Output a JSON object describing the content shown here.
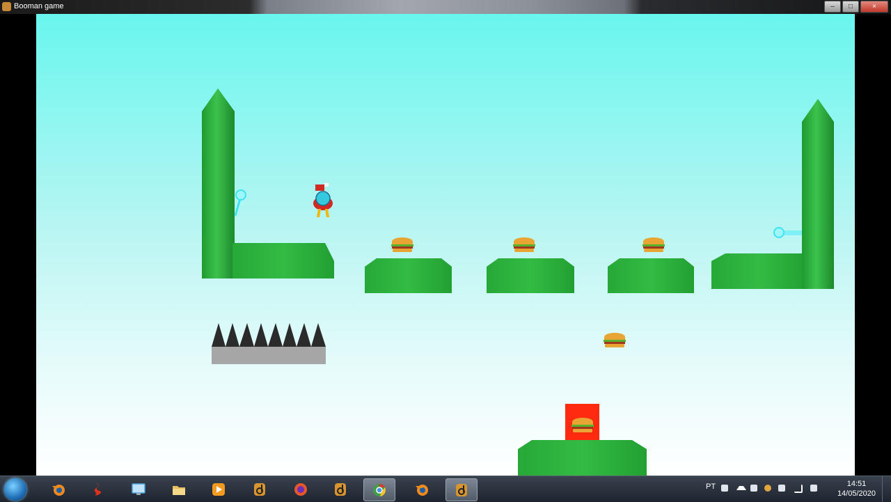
{
  "window": {
    "title": "Booman game"
  },
  "window_controls": {
    "minimize": "–",
    "maximize": "□",
    "close": "×"
  },
  "taskbar": {
    "apps": [
      {
        "name": "start-orb",
        "icon": "windows-logo-icon"
      },
      {
        "name": "blender",
        "icon": "blender-icon",
        "color": "#f08a1c"
      },
      {
        "name": "app-red",
        "icon": "red-s-icon",
        "color": "#e0311e"
      },
      {
        "name": "control-panel",
        "icon": "monitor-icon",
        "color": "#4aa3df"
      },
      {
        "name": "file-explorer",
        "icon": "folder-icon",
        "color": "#e8c060"
      },
      {
        "name": "media-player",
        "icon": "play-icon",
        "color": "#f29a20"
      },
      {
        "name": "game-app-1",
        "icon": "b-logo-icon",
        "color": "#d8952f"
      },
      {
        "name": "firefox",
        "icon": "firefox-icon",
        "color": "#e9562a"
      },
      {
        "name": "game-app-2",
        "icon": "b-logo-icon",
        "color": "#d8952f"
      },
      {
        "name": "chrome",
        "icon": "chrome-icon",
        "color": "#3f9e47"
      },
      {
        "name": "blender-2",
        "icon": "blender-icon",
        "color": "#f08a1c"
      },
      {
        "name": "game-app-3",
        "icon": "b-logo-icon",
        "color": "#d8952f"
      }
    ],
    "tray": {
      "language": "PT",
      "time": "14:51",
      "date": "14/05/2020"
    }
  },
  "game": {
    "colors": {
      "sky_top": "#68f6ee",
      "sky_bottom": "#ffffff",
      "grass": "#2db33e",
      "grass_dark": "#1f8f2e",
      "spike": "#2b2b2b",
      "spike_base": "#a6a6a6",
      "goal_box": "#ff2a0f",
      "tractor_beam": "#3de3f0"
    },
    "entities": [
      {
        "type": "player",
        "icon": "booman-robot-icon"
      },
      {
        "type": "burger",
        "icon": "burger-icon"
      },
      {
        "type": "burger",
        "icon": "burger-icon"
      },
      {
        "type": "burger",
        "icon": "burger-icon"
      },
      {
        "type": "burger",
        "icon": "burger-icon"
      },
      {
        "type": "goal-burger",
        "icon": "burger-icon"
      },
      {
        "type": "spike-trap",
        "icon": "spikes-icon"
      }
    ]
  }
}
